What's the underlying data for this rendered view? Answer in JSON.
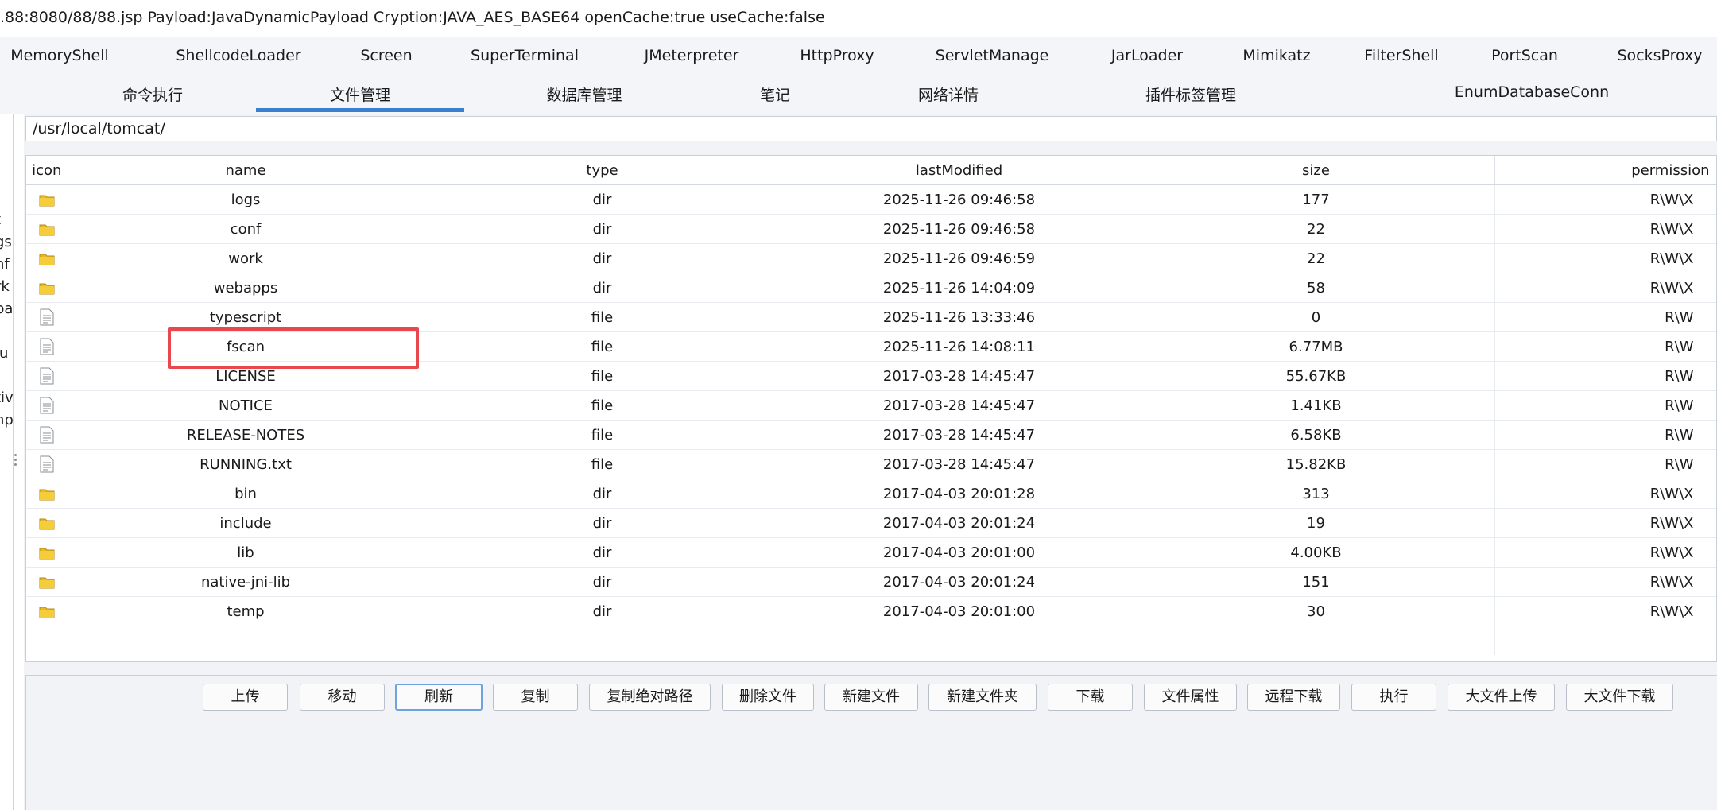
{
  "title": ".88:8080/88/88.jsp Payload:JavaDynamicPayload Cryption:JAVA_AES_BASE64 openCache:true useCache:false",
  "plugin_tabs": [
    "MemoryShell",
    "ShellcodeLoader",
    "Screen",
    "SuperTerminal",
    "JMeterpreter",
    "HttpProxy",
    "ServletManage",
    "JarLoader",
    "Mimikatz",
    "FilterShell",
    "PortScan",
    "SocksProxy"
  ],
  "main_tabs": [
    "命令执行",
    "文件管理",
    "数据库管理",
    "笔记",
    "网络详情",
    "插件标签管理",
    "EnumDatabaseConn"
  ],
  "active_main_tab": "文件管理",
  "left_tree_fragments": [
    "t",
    "gs",
    "nf",
    "rk",
    "ba",
    "",
    "lu",
    "",
    "tiv",
    "np"
  ],
  "path": "/usr/local/tomcat/",
  "columns": [
    "icon",
    "name",
    "type",
    "lastModified",
    "size",
    "permission"
  ],
  "files": [
    {
      "icon": "folder-icon",
      "name": "logs",
      "type": "dir",
      "lastModified": "2025-11-26 09:46:58",
      "size": "177",
      "permission": "R\\W\\X"
    },
    {
      "icon": "folder-icon",
      "name": "conf",
      "type": "dir",
      "lastModified": "2025-11-26 09:46:58",
      "size": "22",
      "permission": "R\\W\\X"
    },
    {
      "icon": "folder-icon",
      "name": "work",
      "type": "dir",
      "lastModified": "2025-11-26 09:46:59",
      "size": "22",
      "permission": "R\\W\\X"
    },
    {
      "icon": "folder-icon",
      "name": "webapps",
      "type": "dir",
      "lastModified": "2025-11-26 14:04:09",
      "size": "58",
      "permission": "R\\W\\X"
    },
    {
      "icon": "file-icon",
      "name": "typescript",
      "type": "file",
      "lastModified": "2025-11-26 13:33:46",
      "size": "0",
      "permission": "R\\W"
    },
    {
      "icon": "file-icon",
      "name": "fscan",
      "type": "file",
      "lastModified": "2025-11-26 14:08:11",
      "size": "6.77MB",
      "permission": "R\\W"
    },
    {
      "icon": "file-icon",
      "name": "LICENSE",
      "type": "file",
      "lastModified": "2017-03-28 14:45:47",
      "size": "55.67KB",
      "permission": "R\\W"
    },
    {
      "icon": "file-icon",
      "name": "NOTICE",
      "type": "file",
      "lastModified": "2017-03-28 14:45:47",
      "size": "1.41KB",
      "permission": "R\\W"
    },
    {
      "icon": "file-icon",
      "name": "RELEASE-NOTES",
      "type": "file",
      "lastModified": "2017-03-28 14:45:47",
      "size": "6.58KB",
      "permission": "R\\W"
    },
    {
      "icon": "file-icon",
      "name": "RUNNING.txt",
      "type": "file",
      "lastModified": "2017-03-28 14:45:47",
      "size": "15.82KB",
      "permission": "R\\W"
    },
    {
      "icon": "folder-icon",
      "name": "bin",
      "type": "dir",
      "lastModified": "2017-04-03 20:01:28",
      "size": "313",
      "permission": "R\\W\\X"
    },
    {
      "icon": "folder-icon",
      "name": "include",
      "type": "dir",
      "lastModified": "2017-04-03 20:01:24",
      "size": "19",
      "permission": "R\\W\\X"
    },
    {
      "icon": "folder-icon",
      "name": "lib",
      "type": "dir",
      "lastModified": "2017-04-03 20:01:00",
      "size": "4.00KB",
      "permission": "R\\W\\X"
    },
    {
      "icon": "folder-icon",
      "name": "native-jni-lib",
      "type": "dir",
      "lastModified": "2017-04-03 20:01:24",
      "size": "151",
      "permission": "R\\W\\X"
    },
    {
      "icon": "folder-icon",
      "name": "temp",
      "type": "dir",
      "lastModified": "2017-04-03 20:01:00",
      "size": "30",
      "permission": "R\\W\\X"
    }
  ],
  "highlighted_file": "fscan",
  "buttons": [
    "上传",
    "移动",
    "刷新",
    "复制",
    "复制绝对路径",
    "删除文件",
    "新建文件",
    "新建文件夹",
    "下载",
    "文件属性",
    "远程下载",
    "执行",
    "大文件上传",
    "大文件下载"
  ],
  "focused_button": "刷新",
  "colors": {
    "accent": "#3b7fd1",
    "highlight_box": "#e8474e",
    "folder": "#e8b923",
    "focus_ring": "#6fa3df"
  }
}
